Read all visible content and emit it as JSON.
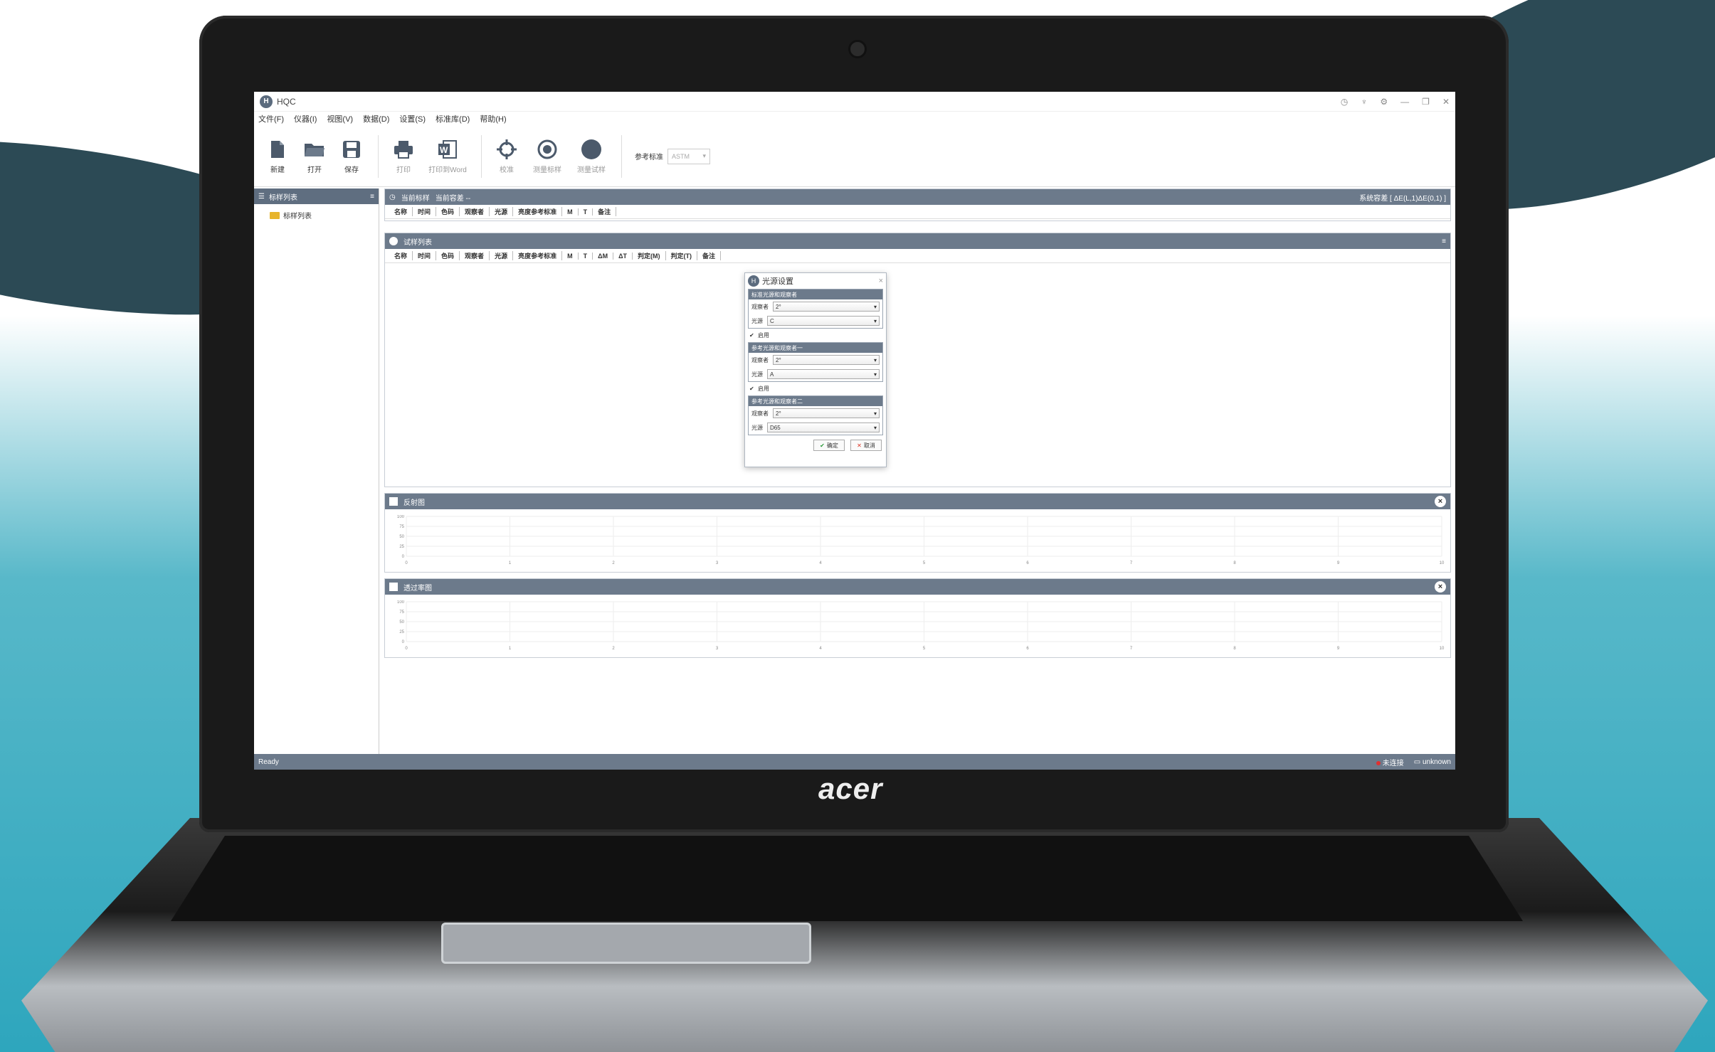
{
  "brand": "acer",
  "window": {
    "logo": "H",
    "title": "HQC",
    "controls": [
      "◷",
      "♆",
      "⚙",
      "—",
      "❐",
      "✕"
    ]
  },
  "menu": [
    "文件(F)",
    "仪器(I)",
    "视图(V)",
    "数据(D)",
    "设置(S)",
    "标准库(D)",
    "帮助(H)"
  ],
  "toolbar": {
    "new": "新建",
    "open": "打开",
    "save": "保存",
    "print": "打印",
    "print_word": "打印到Word",
    "calibrate": "校准",
    "measure_std": "测量标样",
    "measure_sample": "测量试样",
    "ref_label": "参考标准",
    "ref_value": "ASTM"
  },
  "sidebar": {
    "title": "标样列表",
    "item": "标样列表"
  },
  "std_panel": {
    "title": "当前标样",
    "subtitle": "当前容差 --",
    "right": "系统容差 [ ΔE(L,1)ΔE(0,1) ]",
    "columns": [
      "名称",
      "时间",
      "色码",
      "观察者",
      "光源",
      "亮度参考标准",
      "M",
      "T",
      "备注"
    ]
  },
  "sample_panel": {
    "title": "试样列表",
    "columns": [
      "名称",
      "时间",
      "色码",
      "观察者",
      "光源",
      "亮度参考标准",
      "M",
      "T",
      "ΔM",
      "ΔT",
      "判定(M)",
      "判定(T)",
      "备注"
    ]
  },
  "chart1": {
    "title": "反射图",
    "chart_data": {
      "type": "line",
      "x_ticks": [
        "0",
        "1",
        "2",
        "3",
        "4",
        "5",
        "6",
        "7",
        "8",
        "9",
        "10"
      ],
      "y_ticks": [
        "100",
        "75",
        "50",
        "25",
        "0"
      ],
      "series": []
    }
  },
  "chart2": {
    "title": "透过率图",
    "chart_data": {
      "type": "line",
      "x_ticks": [
        "0",
        "1",
        "2",
        "3",
        "4",
        "5",
        "6",
        "7",
        "8",
        "9",
        "10"
      ],
      "y_ticks": [
        "100",
        "75",
        "50",
        "25",
        "0"
      ],
      "series": []
    }
  },
  "dialog": {
    "logo": "H",
    "title": "光源设置",
    "close": "×",
    "group1": {
      "title": "标准光源和观察者",
      "observer_label": "观察者",
      "observer": "2°",
      "light_label": "光源",
      "light": "C"
    },
    "check1": "启用",
    "group2": {
      "title": "参考光源和观察者一",
      "observer_label": "观察者",
      "observer": "2°",
      "light_label": "光源",
      "light": "A"
    },
    "check2": "启用",
    "group3": {
      "title": "参考光源和观察者二",
      "observer_label": "观察者",
      "observer": "2°",
      "light_label": "光源",
      "light": "D65"
    },
    "ok": "确定",
    "cancel": "取消"
  },
  "status": {
    "left": "Ready",
    "conn": "未连接",
    "device": "unknown"
  },
  "colors": {
    "panel_header": "#6c7a8b",
    "status": "#6c7a8b",
    "folder": "#e7b42c"
  }
}
